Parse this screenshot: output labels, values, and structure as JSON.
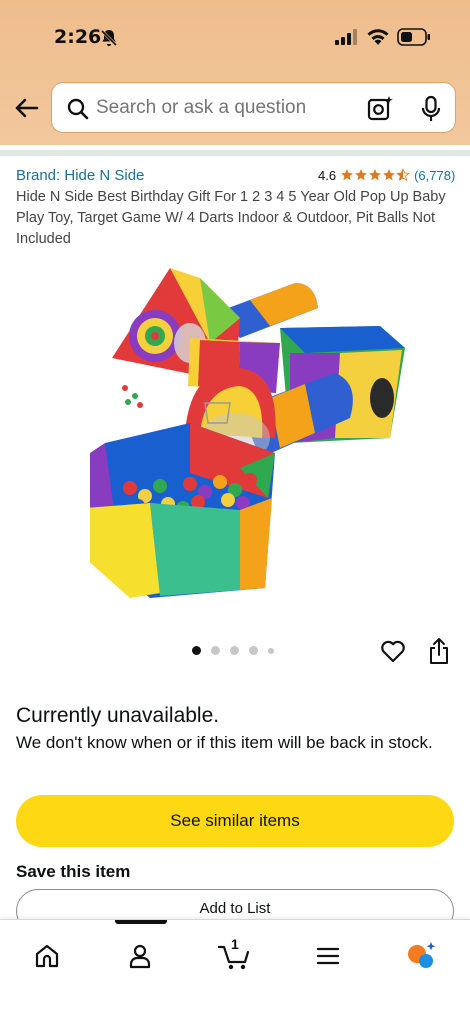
{
  "status_bar": {
    "time": "2:26",
    "icons": [
      "bell-slash-icon",
      "signal-icon",
      "wifi-icon",
      "battery-icon"
    ]
  },
  "search": {
    "placeholder": "Search or ask a question",
    "icons": [
      "back-arrow-icon",
      "search-icon",
      "camera-lens-icon",
      "mic-icon"
    ]
  },
  "product": {
    "brand": "Brand: Hide N Side",
    "rating_value": "4.6",
    "stars": 4.5,
    "rating_count": "(6,778)",
    "title": "Hide N Side Best Birthday Gift For 1 2 3 4 5 Year Old Pop Up Baby Play Toy, Target Game W/ 4 Darts Indoor & Outdoor, Pit Balls Not Included",
    "image_index": 1,
    "image_count": 5
  },
  "availability": {
    "title": "Currently unavailable.",
    "description": "We don't know when or if this item will be back in stock."
  },
  "actions": {
    "similar_label": "See similar items",
    "save_label": "Save this item",
    "add_list_label": "Add to List"
  },
  "bottom_nav": {
    "cart_count": "1",
    "items": [
      "home-icon",
      "account-icon",
      "cart-icon",
      "menu-icon",
      "rufus-ai-icon"
    ]
  },
  "colors": {
    "header_bg": "#efbd8c",
    "link": "#1f6f94",
    "star": "#de7921",
    "primary_button": "#ffd814"
  }
}
